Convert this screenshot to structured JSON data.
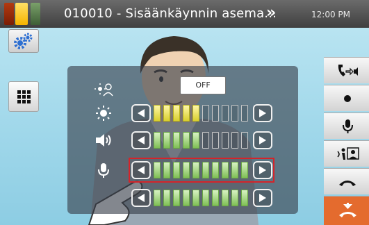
{
  "header": {
    "title": "010010 - Sisäänkäynnin asema...",
    "forward_icon": "»",
    "time": "12:00 PM"
  },
  "panel": {
    "off_button": "OFF",
    "rows": [
      {
        "name": "brightness",
        "icon": "sun-icon",
        "on": 5,
        "total": 10,
        "color": "yellow"
      },
      {
        "name": "volume",
        "icon": "speaker-icon",
        "on": 5,
        "total": 10,
        "color": "green"
      },
      {
        "name": "microphone",
        "icon": "microphone-icon",
        "on": 10,
        "total": 10,
        "color": "green",
        "highlighted": true
      },
      {
        "name": "extra",
        "icon": "",
        "on": 10,
        "total": 10,
        "color": "green"
      }
    ]
  },
  "colors": {
    "highlight": "#d4242a",
    "end_call": "#e46b2e",
    "bar_yellow": "#e8df3a",
    "bar_green": "#8ccc62"
  },
  "right_buttons": [
    "call-transfer-icon",
    "record-icon",
    "microphone-icon",
    "camera-switch-icon",
    "hang-up-icon",
    "end-call-icon"
  ]
}
